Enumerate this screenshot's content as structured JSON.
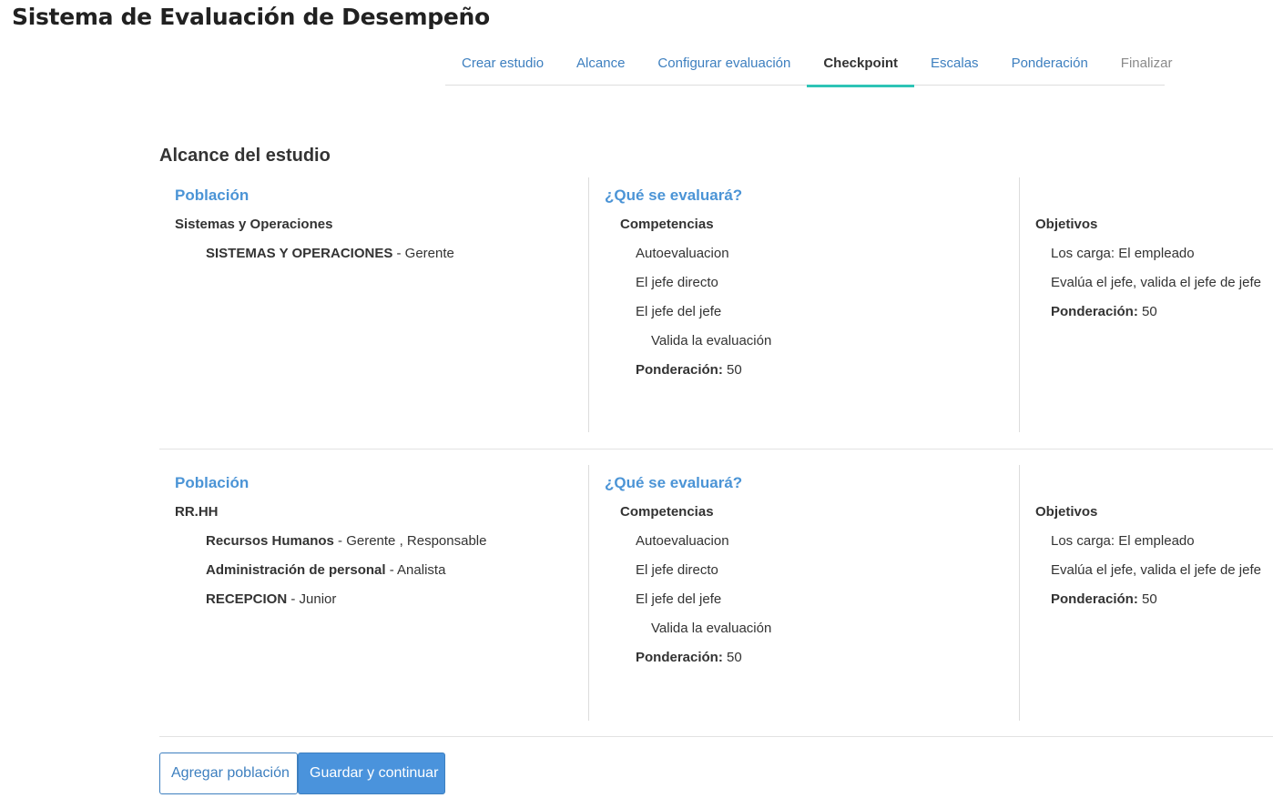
{
  "app": {
    "title": "Sistema de Evaluación de Desempeño"
  },
  "tabs": [
    {
      "label": "Crear estudio",
      "state": "link"
    },
    {
      "label": "Alcance",
      "state": "link"
    },
    {
      "label": "Configurar evaluación",
      "state": "link"
    },
    {
      "label": "Checkpoint",
      "state": "active"
    },
    {
      "label": "Escalas",
      "state": "link"
    },
    {
      "label": "Ponderación",
      "state": "link"
    },
    {
      "label": "Finalizar",
      "state": "disabled"
    }
  ],
  "section": {
    "title": "Alcance del estudio"
  },
  "blocks": [
    {
      "poblacion_label": "Población",
      "group": "Sistemas y Operaciones",
      "units": [
        {
          "name": "SISTEMAS Y OPERACIONES",
          "roles": " - Gerente"
        }
      ],
      "que_label": "¿Qué se evaluará?",
      "competencias": {
        "label": "Competencias",
        "items": [
          "Autoevaluacion",
          "El jefe directo",
          "El jefe del jefe"
        ],
        "validation": "Valida la evaluación",
        "ponderacion_label": "Ponderación:",
        "ponderacion_value": "50"
      },
      "objetivos": {
        "label": "Objetivos",
        "items": [
          "Los carga: El empleado",
          "Evalúa el jefe, valida el jefe de jefe"
        ],
        "ponderacion_label": "Ponderación:",
        "ponderacion_value": "50"
      }
    },
    {
      "poblacion_label": "Población",
      "group": "RR.HH",
      "units": [
        {
          "name": "Recursos Humanos",
          "roles": " - Gerente , Responsable"
        },
        {
          "name": "Administración de personal",
          "roles": " - Analista"
        },
        {
          "name": "RECEPCION",
          "roles": " - Junior"
        }
      ],
      "que_label": "¿Qué se evaluará?",
      "competencias": {
        "label": "Competencias",
        "items": [
          "Autoevaluacion",
          "El jefe directo",
          "El jefe del jefe"
        ],
        "validation": "Valida la evaluación",
        "ponderacion_label": "Ponderación:",
        "ponderacion_value": "50"
      },
      "objetivos": {
        "label": "Objetivos",
        "items": [
          "Los carga: El empleado",
          "Evalúa el jefe, valida el jefe de jefe"
        ],
        "ponderacion_label": "Ponderación:",
        "ponderacion_value": "50"
      }
    }
  ],
  "buttons": {
    "add_population": "Agregar población",
    "save_continue": "Guardar y continuar"
  },
  "colors": {
    "link": "#3d7fbf",
    "heading_blue": "#4b94d6",
    "active_tab_underline": "#2ec4b6",
    "primary_button": "#4a93dc"
  }
}
